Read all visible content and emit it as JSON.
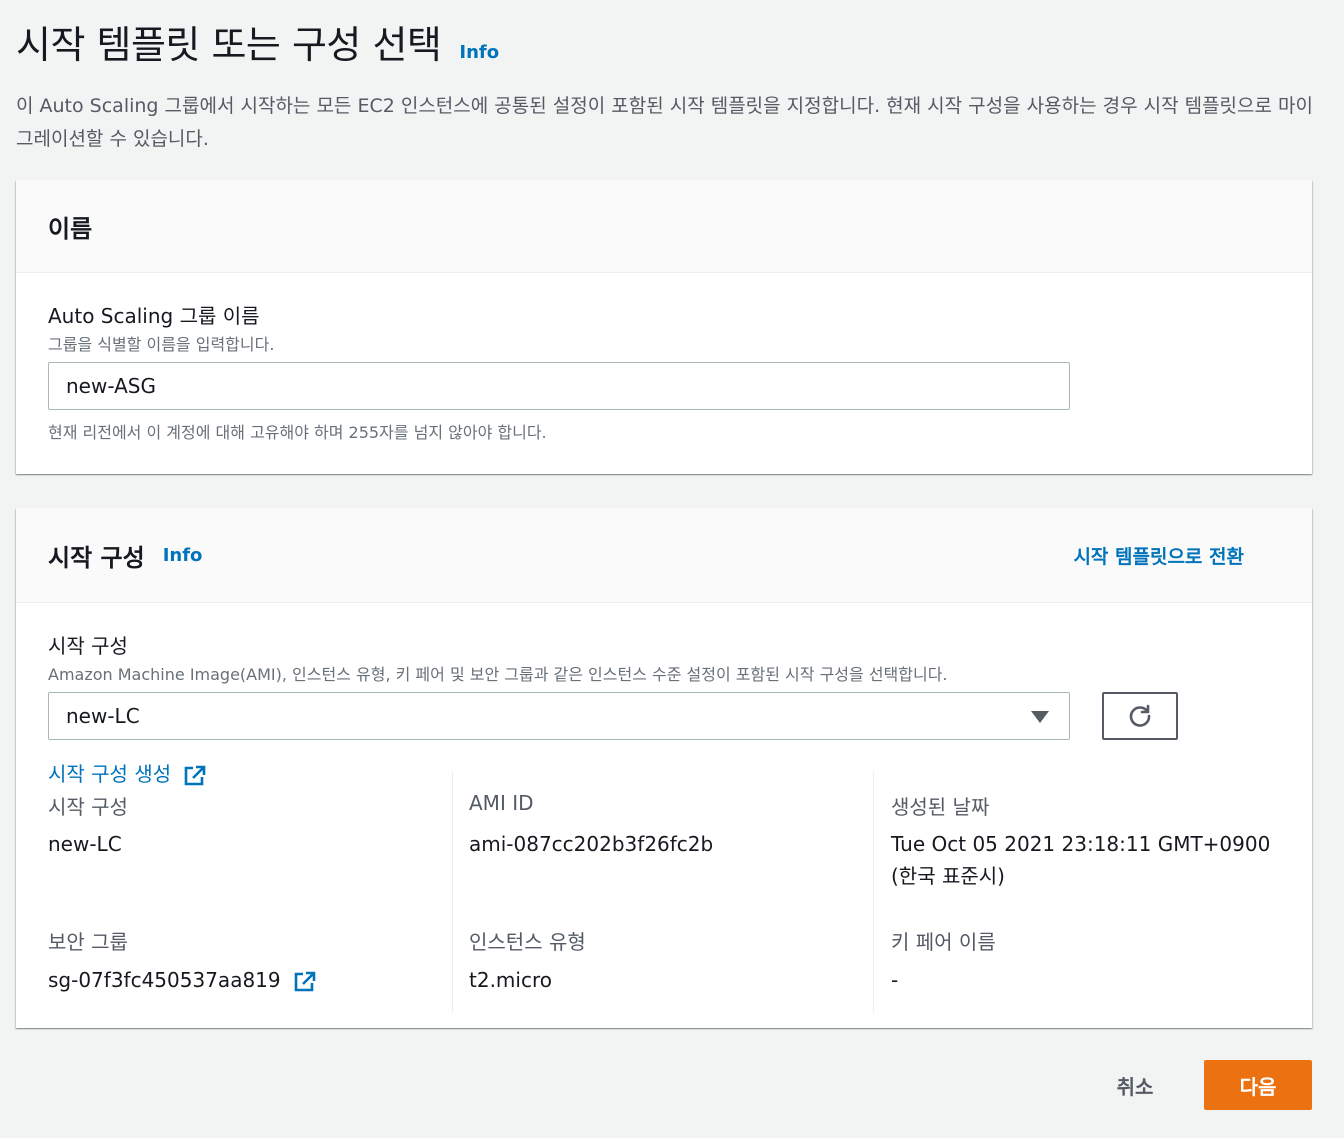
{
  "page": {
    "title": "시작 템플릿 또는 구성 선택",
    "info": "Info",
    "description": "이 Auto Scaling 그룹에서 시작하는 모든 EC2 인스턴스에 공통된 설정이 포함된 시작 템플릿을 지정합니다. 현재 시작 구성을 사용하는 경우 시작 템플릿으로 마이그레이션할 수 있습니다."
  },
  "name_panel": {
    "title": "이름",
    "field_label": "Auto Scaling 그룹 이름",
    "field_desc": "그룹을 식별할 이름을 입력합니다.",
    "value": "new-ASG",
    "constraint": "현재 리전에서 이 계정에 대해 고유해야 하며 255자를 넘지 않아야 합니다."
  },
  "launch_panel": {
    "title": "시작 구성",
    "info": "Info",
    "switch_link": "시작 템플릿으로 전환",
    "field_label": "시작 구성",
    "field_desc": "Amazon Machine Image(AMI), 인스턴스 유형, 키 페어 및 보안 그룹과 같은 인스턴스 수준 설정이 포함된 시작 구성을 선택합니다.",
    "selected": "new-LC",
    "create_link": "시작 구성 생성",
    "details": {
      "launch_config_key": "시작 구성",
      "launch_config_val": "new-LC",
      "ami_key": "AMI ID",
      "ami_val": "ami-087cc202b3f26fc2b",
      "created_key": "생성된 날짜",
      "created_val_line1": "Tue Oct 05 2021 23:18:11 GMT+0900",
      "created_val_line2": "(한국 표준시)",
      "sg_key": "보안 그룹",
      "sg_val": "sg-07f3fc450537aa819",
      "type_key": "인스턴스 유형",
      "type_val": "t2.micro",
      "keypair_key": "키 페어 이름",
      "keypair_val": "-"
    }
  },
  "footer": {
    "cancel": "취소",
    "next": "다음"
  },
  "colors": {
    "link": "#0073bb",
    "primary": "#ec7211",
    "background": "#f2f3f3"
  }
}
